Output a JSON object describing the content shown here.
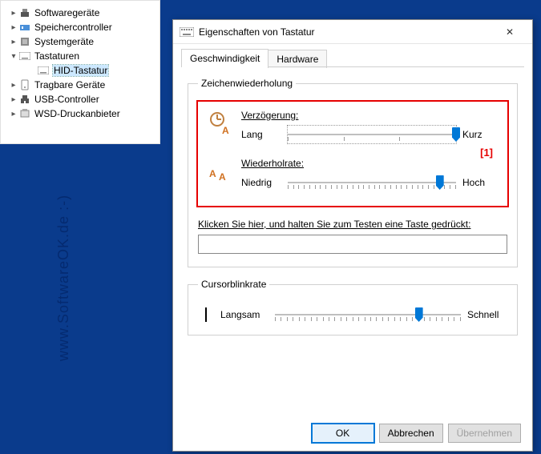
{
  "tree": {
    "items": [
      {
        "label": "Softwaregeräte",
        "expanded": false
      },
      {
        "label": "Speichercontroller",
        "expanded": false
      },
      {
        "label": "Systemgeräte",
        "expanded": false
      },
      {
        "label": "Tastaturen",
        "expanded": true,
        "children": [
          {
            "label": "HID-Tastatur",
            "selected": true
          }
        ]
      },
      {
        "label": "Tragbare Geräte",
        "expanded": false
      },
      {
        "label": "USB-Controller",
        "expanded": false
      },
      {
        "label": "WSD-Druckanbieter",
        "expanded": false
      }
    ]
  },
  "dialog": {
    "title": "Eigenschaften von Tastatur",
    "tabs": [
      {
        "label": "Geschwindigkeit",
        "active": true
      },
      {
        "label": "Hardware",
        "active": false
      }
    ],
    "repeat_group": {
      "legend": "Zeichenwiederholung",
      "annotation": "[1]",
      "delay": {
        "label": "Verzögerung:",
        "left": "Lang",
        "right": "Kurz",
        "value": 3,
        "max": 3
      },
      "rate": {
        "label": "Wiederholrate:",
        "left": "Niedrig",
        "right": "Hoch",
        "value": 28,
        "max": 31
      },
      "test_label": "Klicken Sie hier, und halten Sie zum Testen eine Taste gedrückt:",
      "test_value": ""
    },
    "cursor_group": {
      "legend": "Cursorblinkrate",
      "left": "Langsam",
      "right": "Schnell",
      "value": 24,
      "max": 31
    },
    "buttons": {
      "ok": "OK",
      "cancel": "Abbrechen",
      "apply": "Übernehmen"
    }
  },
  "watermark": "www.SoftwareOK.de  :-)"
}
